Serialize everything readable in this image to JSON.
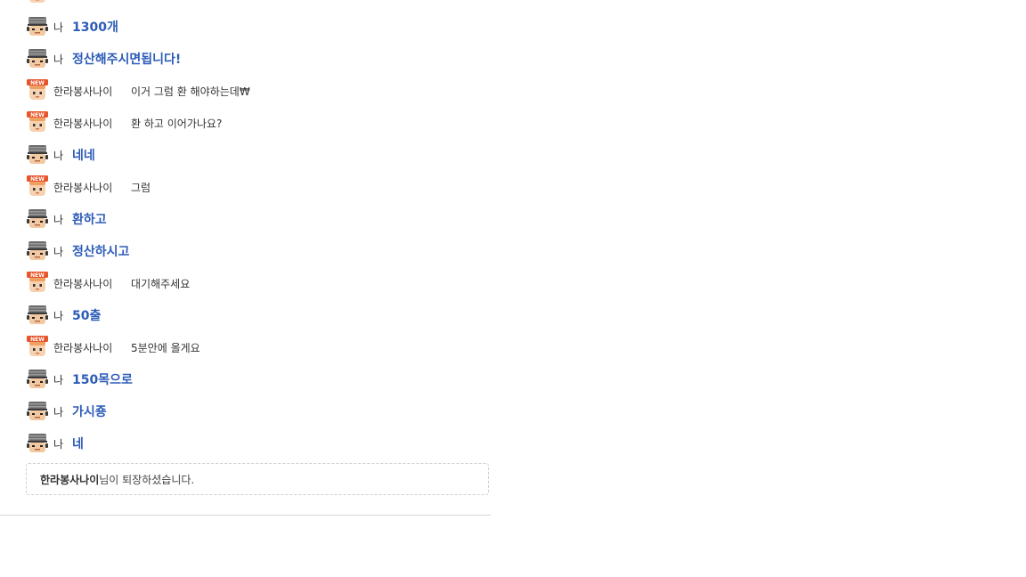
{
  "me_label": "나",
  "other_label": "한라봉사나이",
  "avatars": {
    "me": "soldier-avatar-icon",
    "other": "new-user-avatar-icon"
  },
  "messages": [
    {
      "from": "me",
      "text": "1300개"
    },
    {
      "from": "me",
      "text": "정산해주시면됩니다!"
    },
    {
      "from": "other",
      "text": "이거 그럼 환 해야하는데₩"
    },
    {
      "from": "other",
      "text": "환 하고 이어가나요?"
    },
    {
      "from": "me",
      "text": "네네"
    },
    {
      "from": "other",
      "text": "그럼"
    },
    {
      "from": "me",
      "text": "환하고"
    },
    {
      "from": "me",
      "text": "정산하시고"
    },
    {
      "from": "other",
      "text": "대기해주세요"
    },
    {
      "from": "me",
      "text": "50출"
    },
    {
      "from": "other",
      "text": "5분안에 올게요"
    },
    {
      "from": "me",
      "text": "150목으로"
    },
    {
      "from": "me",
      "text": "가시죵"
    },
    {
      "from": "me",
      "text": "네"
    }
  ],
  "notice": {
    "nickname": "한라봉사나이",
    "suffix": "님이 퇴장하셨습니다."
  },
  "colors": {
    "my_text": "#2d5cb8",
    "other_text": "#333333",
    "new_badge": "#e8542a"
  }
}
